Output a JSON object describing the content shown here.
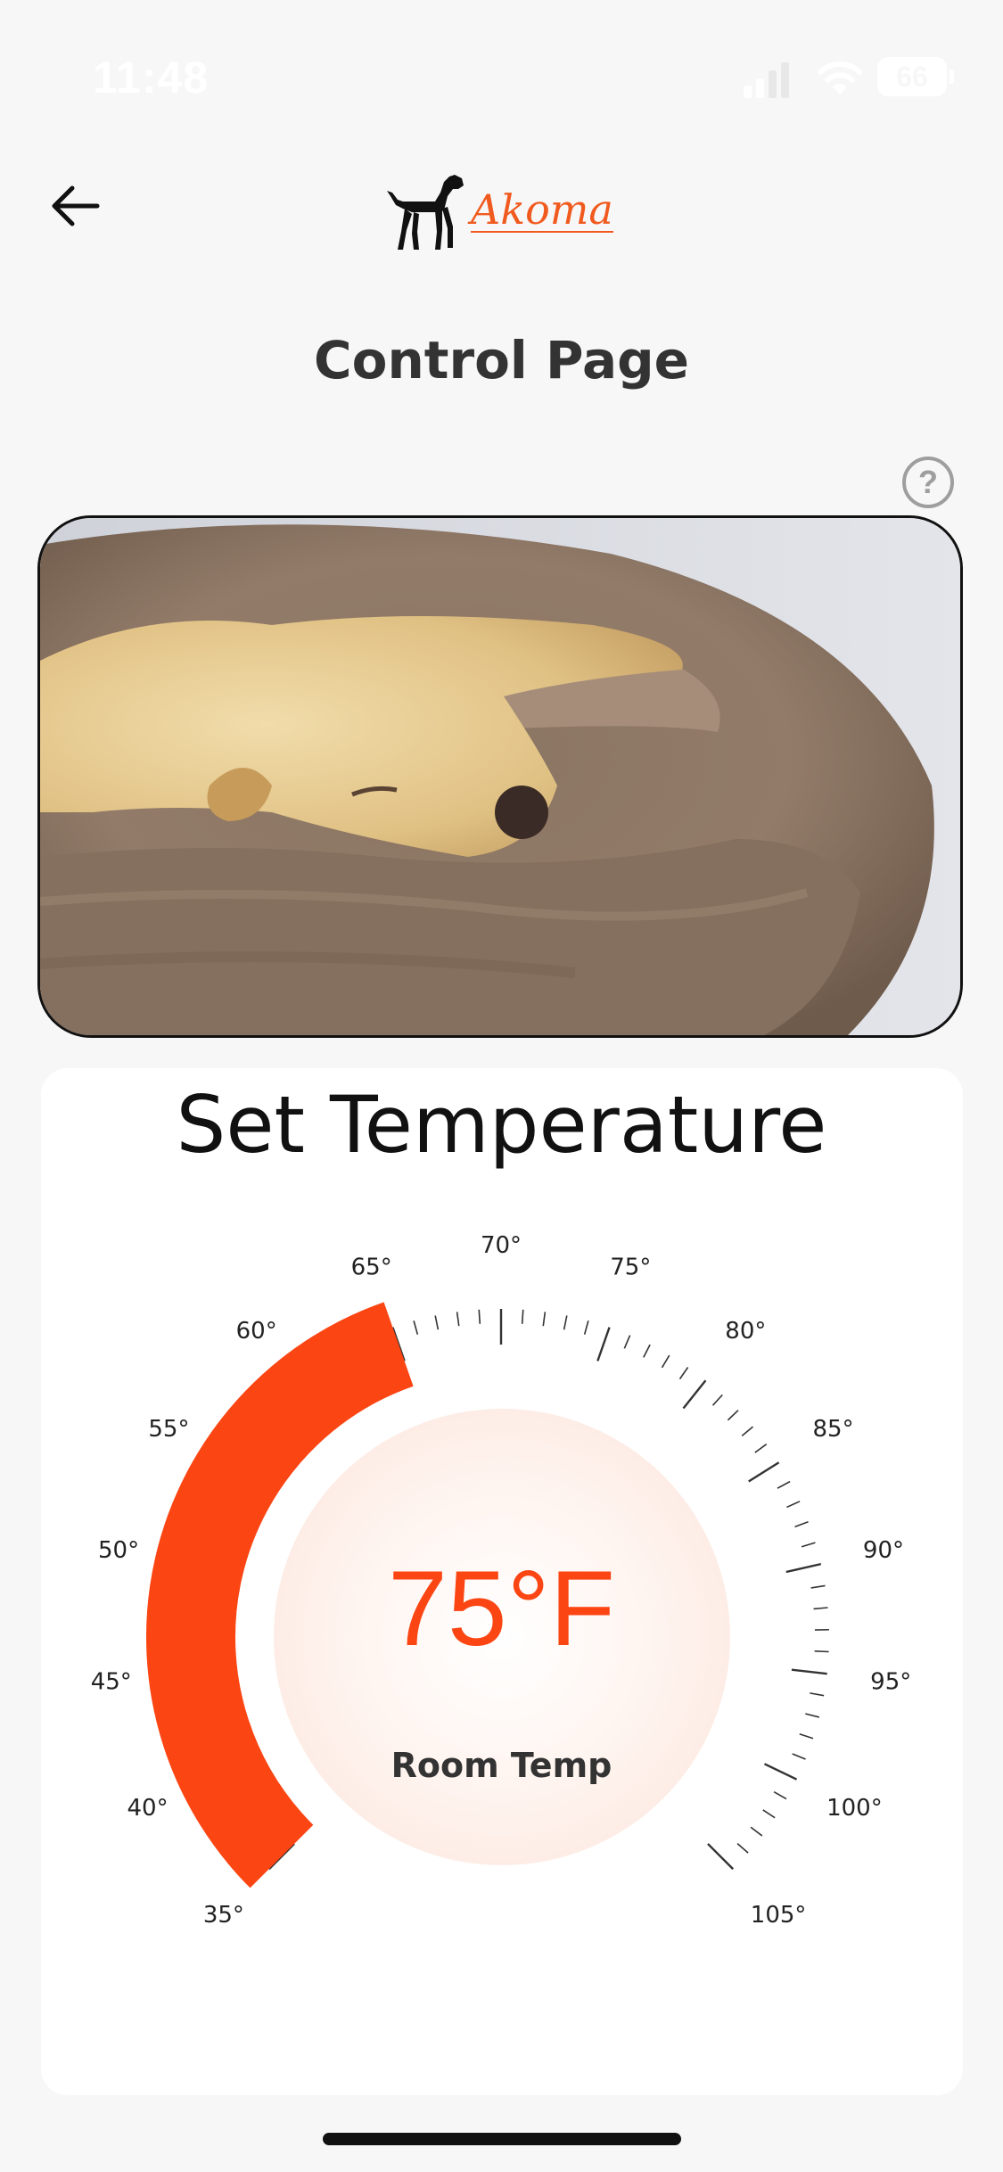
{
  "status_bar": {
    "time": "11:48",
    "battery": "66"
  },
  "header": {
    "back_icon": "arrow-left-icon",
    "logo_icon": "dog-silhouette-icon",
    "logo_text": "Akoma",
    "title": "Control Page",
    "help_icon": "question-circle-icon",
    "help_label": "?"
  },
  "hero": {
    "description_icon": "photo"
  },
  "temperature": {
    "title": "Set Temperature",
    "value": "75°F",
    "label": "Room Temp",
    "unit": "°F",
    "scale_min": 35,
    "scale_max": 105,
    "setpoint": 65,
    "accent_color": "#fb4513",
    "tick_labels": [
      "35°",
      "40°",
      "45°",
      "50°",
      "55°",
      "60°",
      "65°",
      "70°",
      "75°",
      "80°",
      "85°",
      "90°",
      "95°",
      "100°",
      "105°"
    ]
  }
}
